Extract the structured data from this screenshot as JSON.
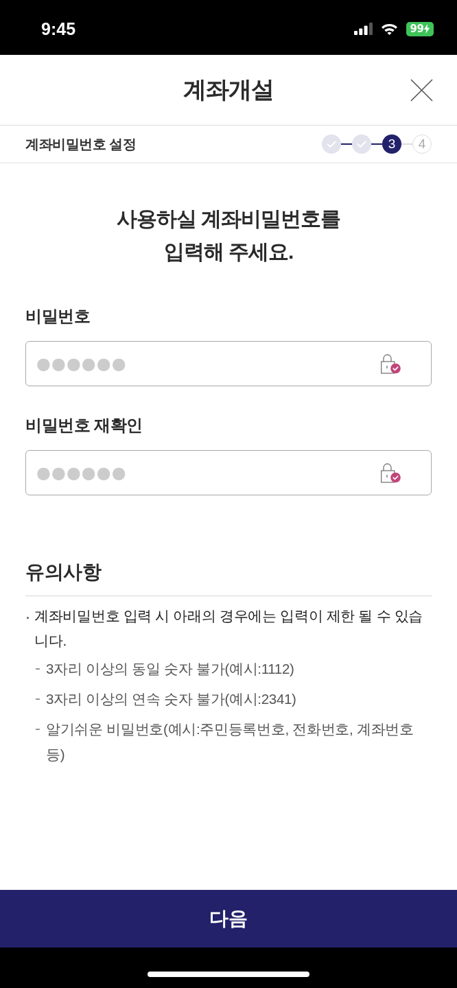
{
  "status_bar": {
    "time": "9:45",
    "battery": "99"
  },
  "header": {
    "title": "계좌개설"
  },
  "progress": {
    "label": "계좌비밀번호 설정",
    "steps": [
      {
        "completed": true,
        "selected": false
      },
      {
        "completed": true,
        "selected": false
      },
      {
        "completed": false,
        "selected": true,
        "number": "3"
      },
      {
        "completed": false,
        "selected": false,
        "number": "4"
      }
    ]
  },
  "heading": [
    "사용하실 계좌비밀번호를",
    "입력해 주세요."
  ],
  "fields": [
    {
      "label": "비밀번호",
      "value": "●●●●●●"
    },
    {
      "label": "비밀번호 재확인",
      "value": "●●●●●●"
    }
  ],
  "notice": {
    "title": "유의사항",
    "items": [
      {
        "kind": "bullet",
        "text": "계좌비밀번호 입력 시 아래의 경우에는 입력이 제한 될 수 있습니다."
      },
      {
        "kind": "dash",
        "text": "3자리 이상의 동일 숫자 불가(예시:1112)"
      },
      {
        "kind": "dash",
        "text": "3자리 이상의 연속 숫자 불가(예시:2341)"
      },
      {
        "kind": "dash",
        "text": "알기쉬운 비밀번호(예시:주민등록번호, 전화번호, 계좌번호 등)"
      }
    ]
  },
  "next_button": {
    "label": "다음"
  }
}
